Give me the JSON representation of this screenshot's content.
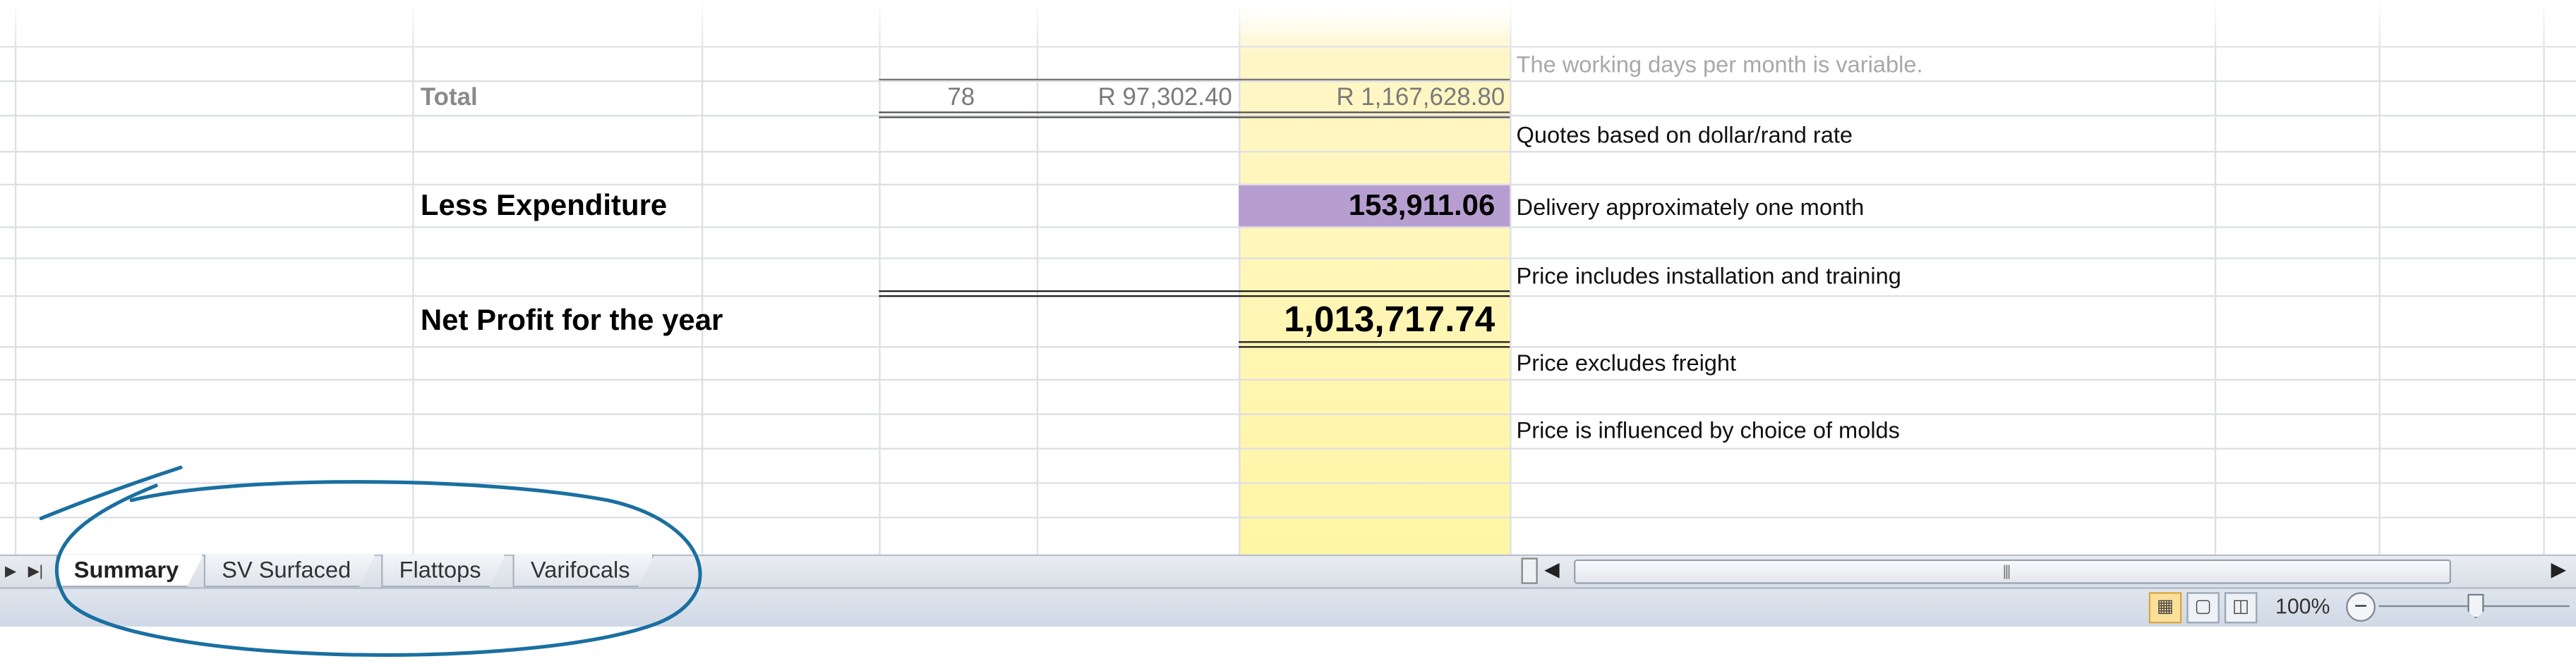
{
  "spreadsheet": {
    "note_top": "The working days per month is variable.",
    "total_row": {
      "label": "Total",
      "days": "78",
      "monthly": "R 97,302.40",
      "annual": "R 1,167,628.80"
    },
    "notes": [
      "Quotes based on dollar/rand rate",
      "Delivery approximately one month",
      "Price includes installation and training",
      "Price excludes freight",
      "Price is influenced by choice of molds"
    ],
    "less_expenditure": {
      "label": "Less Expenditure",
      "value": "153,911.06"
    },
    "net_profit": {
      "label": "Net Profit for the year",
      "value": "1,013,717.74"
    }
  },
  "sheet_tabs": [
    {
      "label": "Summary",
      "active": true
    },
    {
      "label": "SV Surfaced",
      "active": false
    },
    {
      "label": "Flattops",
      "active": false
    },
    {
      "label": "Varifocals",
      "active": false
    }
  ],
  "status_bar": {
    "zoom": "100%",
    "zoom_out": "−",
    "view_normal_icon": "grid-icon",
    "view_layout_icon": "page-icon",
    "view_break_icon": "page-break-icon"
  },
  "colors": {
    "annotation": "#1a6fa0",
    "highlight_yellow": "#fff6a4",
    "highlight_purple": "#b79ed1"
  }
}
